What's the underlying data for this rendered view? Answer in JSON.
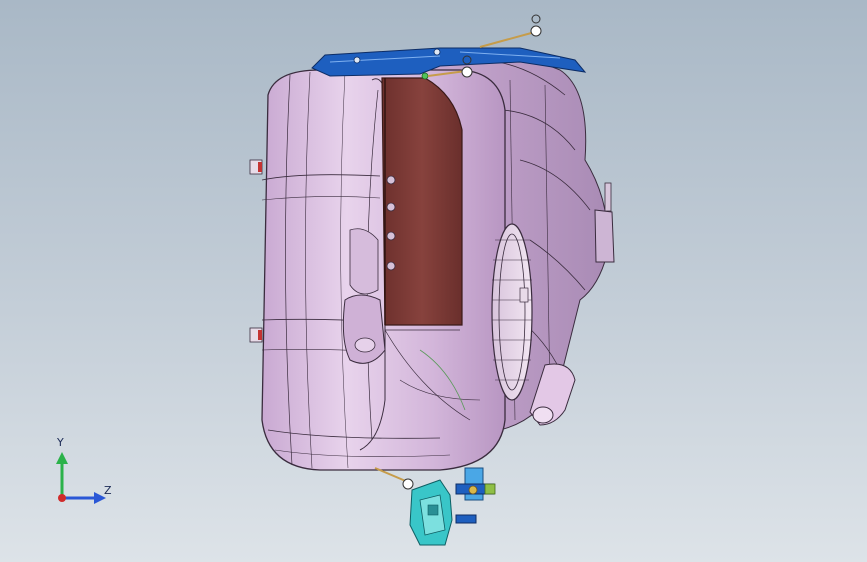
{
  "viewport": {
    "background_top": "#a9b8c6",
    "background_bottom": "#dde3e8"
  },
  "model": {
    "tank_color": "#d9bfe0",
    "edge_color": "#3a2c3e",
    "panel_color": "#7b3a36",
    "bracket_top_color": "#1e5fbf",
    "bracket_bottom_color": "#39c6c8"
  },
  "triad": {
    "y_label": "Y",
    "z_label": "Z",
    "y_color": "#2bb24a",
    "z_color": "#2a57d6",
    "x_color": "#d02b2b"
  }
}
